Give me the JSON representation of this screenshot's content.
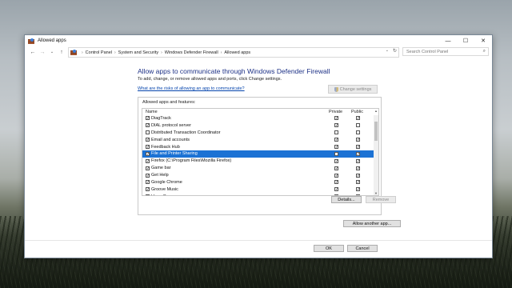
{
  "window": {
    "title": "Allowed apps",
    "controls": [
      "—",
      "☐",
      "✕"
    ]
  },
  "address": {
    "breadcrumbs": [
      "Control Panel",
      "System and Security",
      "Windows Defender Firewall",
      "Allowed apps"
    ],
    "search_placeholder": "Search Control Panel"
  },
  "main": {
    "heading": "Allow apps to communicate through Windows Defender Firewall",
    "subtext": "To add, change, or remove allowed apps and ports, click Change settings.",
    "risk_link": "What are the risks of allowing an app to communicate?",
    "change_settings_label": "Change settings",
    "group_title": "Allowed apps and features:",
    "columns": {
      "name": "Name",
      "private": "Private",
      "public": "Public"
    },
    "apps": [
      {
        "name": "DiagTrack",
        "enabled": true,
        "private": true,
        "public": true,
        "selected": false
      },
      {
        "name": "DIAL protocol server",
        "enabled": true,
        "private": true,
        "public": false,
        "selected": false
      },
      {
        "name": "Distributed Transaction Coordinator",
        "enabled": false,
        "private": false,
        "public": false,
        "selected": false
      },
      {
        "name": "Email and accounts",
        "enabled": true,
        "private": true,
        "public": true,
        "selected": false
      },
      {
        "name": "Feedback Hub",
        "enabled": true,
        "private": true,
        "public": true,
        "selected": false
      },
      {
        "name": "File and Printer Sharing",
        "enabled": true,
        "private": false,
        "public": true,
        "selected": true
      },
      {
        "name": "Firefox (C:\\Program Files\\Mozilla Firefox)",
        "enabled": true,
        "private": true,
        "public": true,
        "selected": false
      },
      {
        "name": "Game bar",
        "enabled": true,
        "private": true,
        "public": true,
        "selected": false
      },
      {
        "name": "Get Help",
        "enabled": true,
        "private": true,
        "public": true,
        "selected": false
      },
      {
        "name": "Google Chrome",
        "enabled": true,
        "private": true,
        "public": true,
        "selected": false
      },
      {
        "name": "Groove Music",
        "enabled": true,
        "private": true,
        "public": true,
        "selected": false
      },
      {
        "name": "HomeGroup",
        "enabled": false,
        "private": false,
        "public": false,
        "selected": false
      }
    ],
    "details_label": "Details...",
    "remove_label": "Remove",
    "allow_another_label": "Allow another app..."
  },
  "footer": {
    "ok_label": "OK",
    "cancel_label": "Cancel"
  },
  "colors": {
    "heading": "#1e3287",
    "link": "#0645ad",
    "selection": "#1c72d4"
  }
}
